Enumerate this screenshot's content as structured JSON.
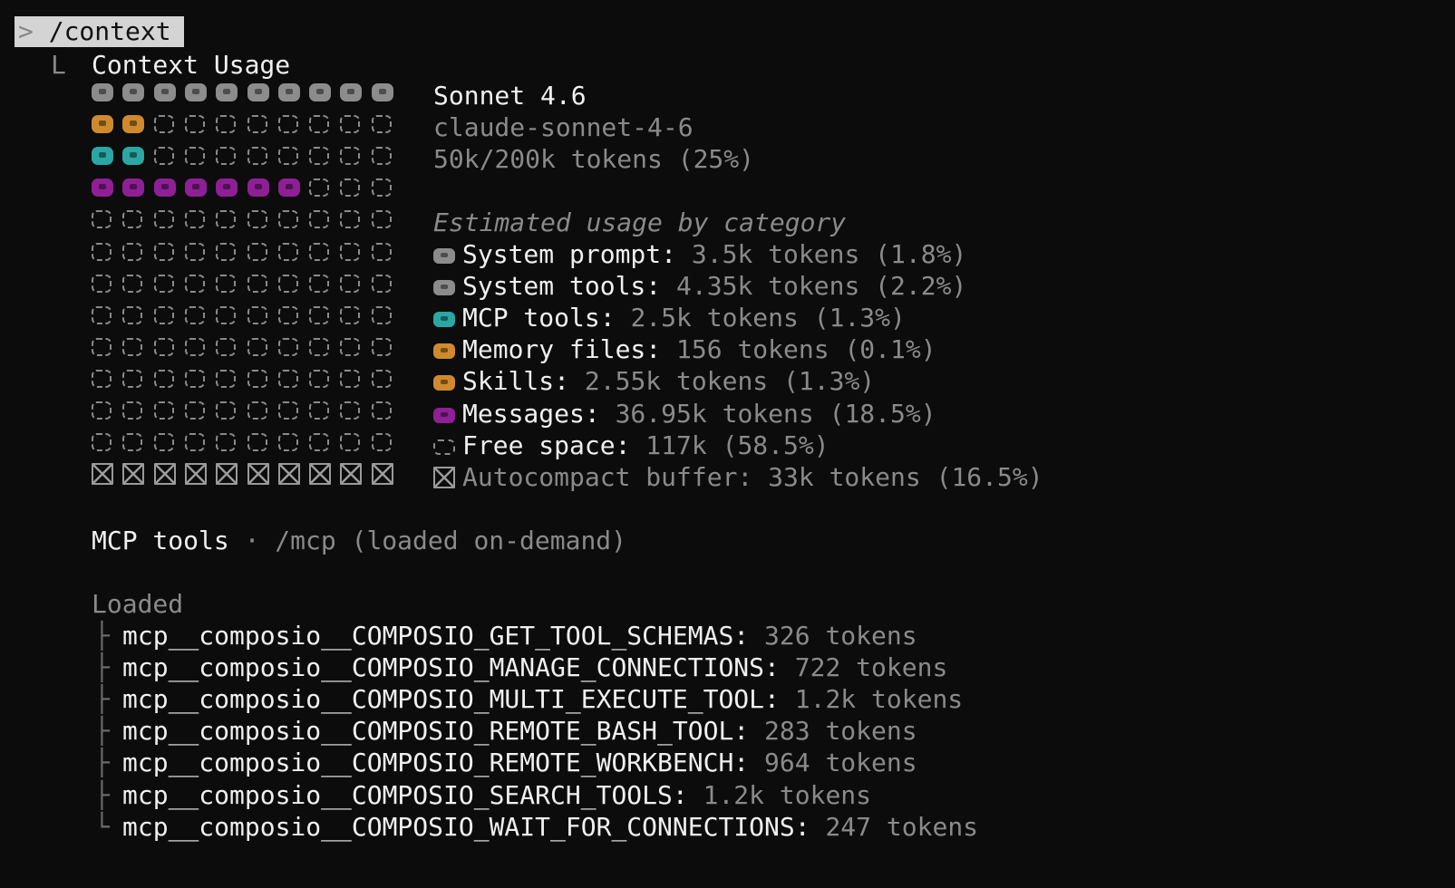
{
  "command": {
    "caret": ">",
    "text": "/context"
  },
  "header": {
    "branch": "L",
    "title": "Context Usage"
  },
  "model": {
    "name": "Sonnet 4.6",
    "id": "claude-sonnet-4-6",
    "usage": "50k/200k tokens (25%)"
  },
  "colors": {
    "system": "#8c8c8c",
    "memory": "#d08a2e",
    "mcp": "#2aa7a4",
    "messages": "#8e1f95",
    "free": "#8a8a8a",
    "buffer": "#9a9a9a"
  },
  "grid_rows": [
    [
      "system",
      "system",
      "system",
      "system",
      "system",
      "system",
      "system",
      "system",
      "system",
      "system"
    ],
    [
      "memory",
      "memory",
      "free",
      "free",
      "free",
      "free",
      "free",
      "free",
      "free",
      "free"
    ],
    [
      "mcp",
      "mcp",
      "free",
      "free",
      "free",
      "free",
      "free",
      "free",
      "free",
      "free"
    ],
    [
      "messages",
      "messages",
      "messages",
      "messages",
      "messages",
      "messages",
      "messages",
      "free",
      "free",
      "free"
    ],
    [
      "free",
      "free",
      "free",
      "free",
      "free",
      "free",
      "free",
      "free",
      "free",
      "free"
    ],
    [
      "free",
      "free",
      "free",
      "free",
      "free",
      "free",
      "free",
      "free",
      "free",
      "free"
    ],
    [
      "free",
      "free",
      "free",
      "free",
      "free",
      "free",
      "free",
      "free",
      "free",
      "free"
    ],
    [
      "free",
      "free",
      "free",
      "free",
      "free",
      "free",
      "free",
      "free",
      "free",
      "free"
    ],
    [
      "free",
      "free",
      "free",
      "free",
      "free",
      "free",
      "free",
      "free",
      "free",
      "free"
    ],
    [
      "free",
      "free",
      "free",
      "free",
      "free",
      "free",
      "free",
      "free",
      "free",
      "free"
    ],
    [
      "free",
      "free",
      "free",
      "free",
      "free",
      "free",
      "free",
      "free",
      "free",
      "free"
    ],
    [
      "free",
      "free",
      "free",
      "free",
      "free",
      "free",
      "free",
      "free",
      "free",
      "free"
    ],
    [
      "buffer",
      "buffer",
      "buffer",
      "buffer",
      "buffer",
      "buffer",
      "buffer",
      "buffer",
      "buffer",
      "buffer"
    ]
  ],
  "categories": {
    "heading": "Estimated usage by category",
    "items": [
      {
        "icon": "system",
        "label": "System prompt:",
        "value": "3.5k tokens (1.8%)"
      },
      {
        "icon": "system",
        "label": "System tools:",
        "value": "4.35k tokens (2.2%)"
      },
      {
        "icon": "mcp",
        "label": "MCP tools:",
        "value": "2.5k tokens (1.3%)"
      },
      {
        "icon": "memory",
        "label": "Memory files:",
        "value": "156 tokens (0.1%)"
      },
      {
        "icon": "memory",
        "label": "Skills:",
        "value": "2.55k tokens (1.3%)"
      },
      {
        "icon": "messages",
        "label": "Messages:",
        "value": "36.95k tokens (18.5%)"
      },
      {
        "icon": "free",
        "label": "Free space:",
        "value": "117k (58.5%)"
      },
      {
        "icon": "buffer",
        "label": "Autocompact buffer: 33k tokens (16.5%)",
        "value": ""
      }
    ]
  },
  "mcp": {
    "title": "MCP tools",
    "separator": "·",
    "subtitle": "/mcp (loaded on-demand)",
    "loaded_label": "Loaded",
    "tools": [
      {
        "branch": "├",
        "name": "mcp__composio__COMPOSIO_GET_TOOL_SCHEMAS:",
        "tokens": "326 tokens"
      },
      {
        "branch": "├",
        "name": "mcp__composio__COMPOSIO_MANAGE_CONNECTIONS:",
        "tokens": "722 tokens"
      },
      {
        "branch": "├",
        "name": "mcp__composio__COMPOSIO_MULTI_EXECUTE_TOOL:",
        "tokens": "1.2k tokens"
      },
      {
        "branch": "├",
        "name": "mcp__composio__COMPOSIO_REMOTE_BASH_TOOL:",
        "tokens": "283 tokens"
      },
      {
        "branch": "├",
        "name": "mcp__composio__COMPOSIO_REMOTE_WORKBENCH:",
        "tokens": "964 tokens"
      },
      {
        "branch": "├",
        "name": "mcp__composio__COMPOSIO_SEARCH_TOOLS:",
        "tokens": "1.2k tokens"
      },
      {
        "branch": "└",
        "name": "mcp__composio__COMPOSIO_WAIT_FOR_CONNECTIONS:",
        "tokens": "247 tokens"
      }
    ]
  }
}
